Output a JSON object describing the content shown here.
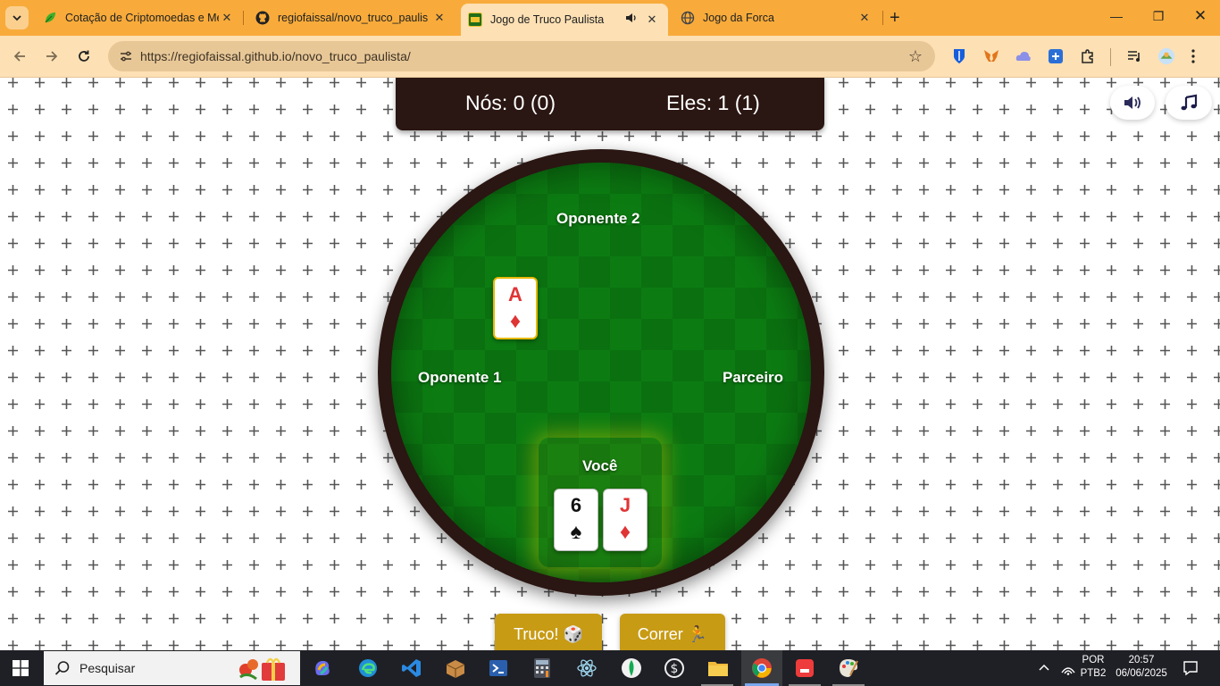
{
  "browser": {
    "tabs": [
      {
        "title": "Cotação de Criptomoedas e Me",
        "favicon": "crypto-leaf-icon",
        "active": false
      },
      {
        "title": "regiofaissal/novo_truco_paulist",
        "favicon": "github-icon",
        "active": false
      },
      {
        "title": "Jogo de Truco Paulista",
        "favicon": "truco-app-icon",
        "active": true,
        "audio": true
      },
      {
        "title": "Jogo da Forca",
        "favicon": "globe-icon",
        "active": false
      }
    ],
    "url": "https://regiofaissal.github.io/novo_truco_paulista/",
    "colors": {
      "tabbar": "#f8ab3b",
      "toolbar": "#fde0b4",
      "omnibox": "#e8c797"
    }
  },
  "game": {
    "score": {
      "us": "Nós: 0 (0)",
      "them": "Eles: 1 (1)"
    },
    "players": {
      "top": "Oponente 2",
      "left": "Oponente 1",
      "right": "Parceiro",
      "bottom": "Você"
    },
    "played_card": {
      "rank": "A",
      "suit": "♦",
      "color": "red"
    },
    "hand": [
      {
        "rank": "6",
        "suit": "♠",
        "color": "black"
      },
      {
        "rank": "J",
        "suit": "♦",
        "color": "red"
      }
    ],
    "buttons": {
      "truco": "Truco! 🎲",
      "run": "Correr 🏃"
    },
    "colors": {
      "felt": "#0c7c12",
      "rim": "#2a1612",
      "button": "#c89b15"
    }
  },
  "taskbar": {
    "search_label": "Pesquisar",
    "lang_top": "POR",
    "lang_bottom": "PTB2",
    "time": "20:57",
    "date": "06/06/2025"
  }
}
